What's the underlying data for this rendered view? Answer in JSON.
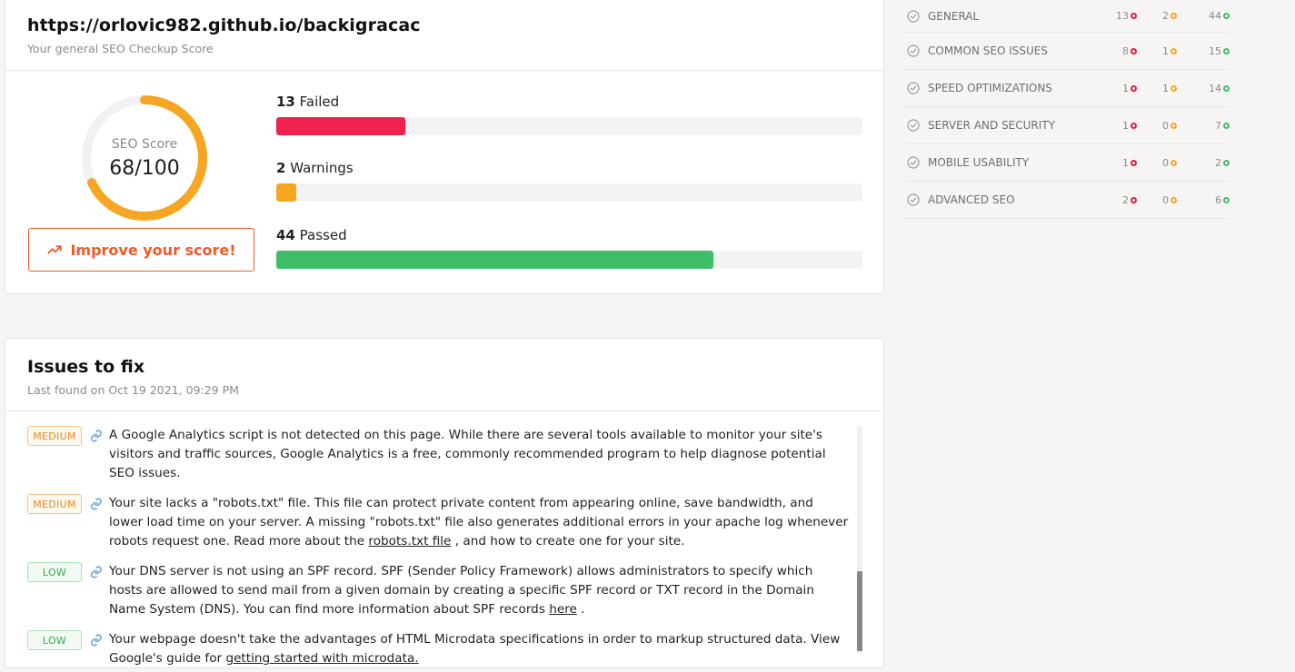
{
  "score_card": {
    "url": "https://orlovic982.github.io/backigracac",
    "subtitle": "Your general SEO Checkup Score",
    "gauge": {
      "label": "SEO Score",
      "value_text": "68/100",
      "score": 68,
      "max": 100,
      "color": "#f6a623"
    },
    "improve_button": "Improve your score!",
    "stats": [
      {
        "count": "13",
        "label": "Failed",
        "fraction": 0.22,
        "color": "#f0204f"
      },
      {
        "count": "2",
        "label": "Warnings",
        "fraction": 0.034,
        "color": "#f6a623"
      },
      {
        "count": "44",
        "label": "Passed",
        "fraction": 0.745,
        "color": "#3fbe68"
      }
    ]
  },
  "issues_card": {
    "title": "Issues to fix",
    "last_found": "Last found on Oct 19 2021, 09:29 PM",
    "issues": [
      {
        "severity": "MEDIUM",
        "text": "A Google Analytics script is not detected on this page. While there are several tools available to monitor your site's visitors and traffic sources, Google Analytics is a free, commonly recommended program to help diagnose potential SEO issues."
      },
      {
        "severity": "MEDIUM",
        "text_before": "Your site lacks a \"robots.txt\" file. This file can protect private content from appearing online, save bandwidth, and lower load time on your server. A missing \"robots.txt\" file also generates additional errors in your apache log whenever robots request one. Read more about the ",
        "link": "robots.txt file",
        "text_after": " , and how to create one for your site."
      },
      {
        "severity": "LOW",
        "text_before": "Your DNS server is not using an SPF record. SPF (Sender Policy Framework) allows administrators to specify which hosts are allowed to send mail from a given domain by creating a specific SPF record or TXT record in the Domain Name System (DNS). You can find more information about SPF records ",
        "link": "here",
        "text_after": " ."
      },
      {
        "severity": "LOW",
        "text_before": "Your webpage doesn't take the advantages of HTML Microdata specifications in order to markup structured data. View Google's guide for ",
        "link": "getting started with microdata.",
        "text_after": ""
      }
    ]
  },
  "sidebar": {
    "categories": [
      {
        "label": "GENERAL",
        "failed": "13",
        "warnings": "2",
        "passed": "44"
      },
      {
        "label": "COMMON SEO ISSUES",
        "failed": "8",
        "warnings": "1",
        "passed": "15"
      },
      {
        "label": "SPEED OPTIMIZATIONS",
        "failed": "1",
        "warnings": "1",
        "passed": "14"
      },
      {
        "label": "SERVER AND SECURITY",
        "failed": "1",
        "warnings": "0",
        "passed": "7"
      },
      {
        "label": "MOBILE USABILITY",
        "failed": "1",
        "warnings": "0",
        "passed": "2"
      },
      {
        "label": "ADVANCED SEO",
        "failed": "2",
        "warnings": "0",
        "passed": "6"
      }
    ]
  }
}
